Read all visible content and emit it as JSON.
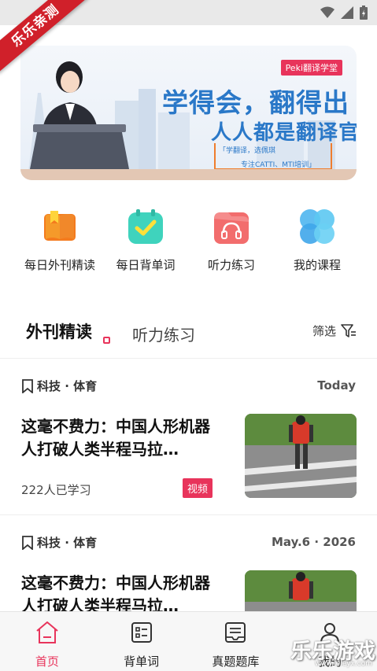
{
  "ribbon": "乐乐亲测",
  "banner": {
    "brand": "Peki翻译学堂",
    "title1": "学得会，翻得出",
    "title2": "人人都是翻译官",
    "sub1": "「学翻译，选佩琪",
    "sub2": "专注CATTI、MTI培训」"
  },
  "quick_menu": [
    {
      "label": "每日外刊精读",
      "icon": "book-icon"
    },
    {
      "label": "每日背单词",
      "icon": "calendar-check-icon"
    },
    {
      "label": "听力练习",
      "icon": "headphones-icon"
    },
    {
      "label": "我的课程",
      "icon": "course-circles-icon"
    }
  ],
  "tabs": {
    "active": "外刊精读",
    "inactive": "听力练习",
    "filter": "筛选"
  },
  "articles": [
    {
      "tag": "科技 · 体育",
      "date": "Today",
      "title": "这毫不费力：中国人形机器人打破人类半程马拉…",
      "learners": "222人已学习",
      "badge": "视频"
    },
    {
      "tag": "科技 · 体育",
      "date": "May.6 · 2026",
      "title": "这毫不费力：中国人形机器人打破人类半程马拉…"
    }
  ],
  "bottom_nav": [
    {
      "label": "首页",
      "icon": "home-icon",
      "active": true
    },
    {
      "label": "背单词",
      "icon": "word-list-icon",
      "active": false
    },
    {
      "label": "真题题库",
      "icon": "question-bank-icon",
      "active": false
    },
    {
      "label": "我的",
      "icon": "profile-icon",
      "active": false
    }
  ],
  "watermark": {
    "text": "乐乐游戏",
    "url": "www.leleyx.com"
  },
  "colors": {
    "accent": "#e8345b",
    "banner_blue": "#2a78c8",
    "ribbon": "#d0202a"
  }
}
